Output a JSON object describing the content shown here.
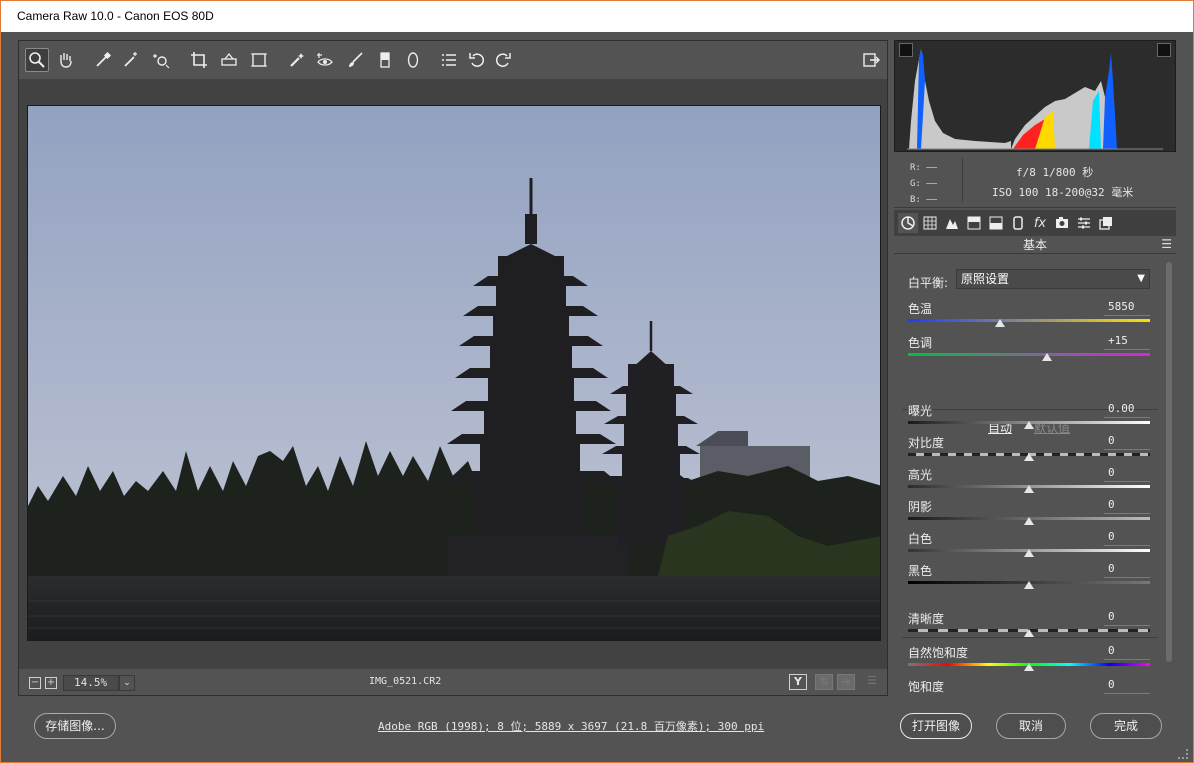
{
  "window": {
    "title": "Camera Raw 10.0 -  Canon EOS 80D"
  },
  "toolbar": {
    "tools": [
      "zoom-icon",
      "hand-icon",
      "white-balance-icon",
      "color-sampler-icon",
      "target-adjust-icon",
      "crop-icon",
      "straighten-icon",
      "transform-icon",
      "spot-removal-icon",
      "red-eye-icon",
      "adjustment-brush-icon",
      "graduated-filter-icon",
      "radial-filter-icon",
      "preferences-icon",
      "rotate-left-icon",
      "rotate-right-icon"
    ],
    "fullscreen_icon": "open-full-screen-icon"
  },
  "status": {
    "zoom_out": "−",
    "zoom_in": "+",
    "zoom": "14.5%",
    "zoom_caret": "⌄",
    "filename": "IMG_0521.CR2",
    "before_after": "Y"
  },
  "histogram": {
    "colors": [
      "#ff2020",
      "#ffd800",
      "#00e0ff",
      "#1060ff",
      "#ffffff"
    ]
  },
  "exif": {
    "r": "R: ——",
    "g": "G: ——",
    "b": "B: ——",
    "line1": "f/8  1/800 秒",
    "line2": "ISO 100  18-200@32 毫米"
  },
  "panel": {
    "tabs": [
      "basic-icon",
      "tone-curve-icon",
      "detail-icon",
      "hsl-icon",
      "split-toning-icon",
      "lens-icon",
      "effects-icon",
      "calibration-icon",
      "presets-icon",
      "snapshots-icon"
    ],
    "title": "基本",
    "menu": "☰",
    "white_balance": {
      "label": "白平衡:",
      "value": "原照设置"
    },
    "auto": "自动",
    "default": "默认值",
    "sliders": [
      {
        "label": "色温",
        "value": "5850",
        "level": 0.38
      },
      {
        "label": "色调",
        "value": "+15",
        "level": 0.575
      },
      {
        "label": "曝光",
        "value": "0.00",
        "level": 0.5
      },
      {
        "label": "对比度",
        "value": "0",
        "level": 0.5
      },
      {
        "label": "高光",
        "value": "0",
        "level": 0.5
      },
      {
        "label": "阴影",
        "value": "0",
        "level": 0.5
      },
      {
        "label": "白色",
        "value": "0",
        "level": 0.5
      },
      {
        "label": "黑色",
        "value": "0",
        "level": 0.5
      },
      {
        "label": "清晰度",
        "value": "0",
        "level": 0.5
      },
      {
        "label": "自然饱和度",
        "value": "0",
        "level": 0.5
      },
      {
        "label": "饱和度",
        "value": "0",
        "level": 0.5
      }
    ]
  },
  "footer": {
    "save": "存储图像...",
    "workflow": "Adobe RGB (1998); 8 位; 5889 x 3697 (21.8 百万像素); 300 ppi",
    "open": "打开图像",
    "cancel": "取消",
    "done": "完成"
  }
}
